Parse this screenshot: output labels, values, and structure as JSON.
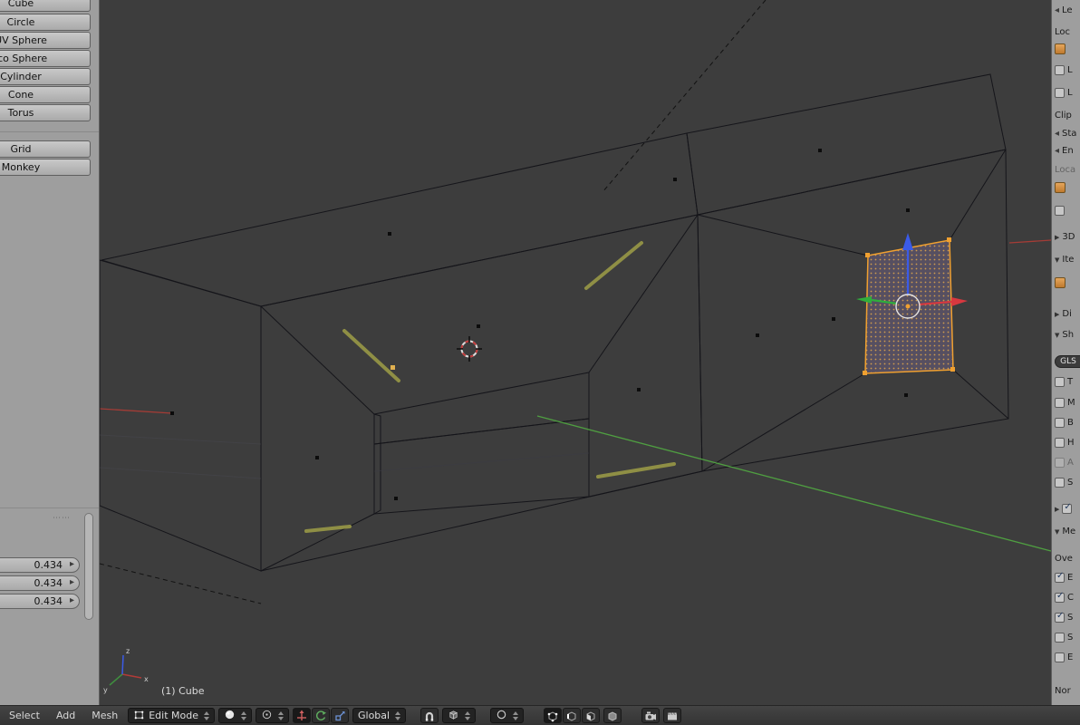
{
  "icons": {
    "dropdown_updown": "up-down arrows",
    "panel_open": "▼",
    "panel_closed": "▶",
    "slider_left": "◂",
    "slider_right": "▸",
    "checkmark": "✓"
  },
  "colors": {
    "selection_accent": "#f0a030",
    "axis_x": "#b23b38",
    "axis_y": "#4f9e41",
    "axis_z": "#3b5be8",
    "viewport_bg": "#3d3d3d",
    "face_front": "#51515e",
    "face_top": "#70707a",
    "face_cap": "#9b9b9d"
  },
  "tool_shelf": {
    "primitive_buttons": [
      "Cube",
      "Circle",
      "UV Sphere",
      "Ico Sphere",
      "Cylinder",
      "Cone",
      "Torus"
    ],
    "extra_buttons": [
      "Grid",
      "Monkey"
    ],
    "transform_fields": [
      "0.434",
      "0.434",
      "0.434"
    ]
  },
  "viewport": {
    "object_info": "(1) Cube",
    "mini_axis": {
      "x": "x",
      "y": "y",
      "z": "z"
    }
  },
  "header": {
    "menus": [
      "Select",
      "Add",
      "Mesh"
    ],
    "mode_dropdown": "Edit Mode",
    "orientation_dropdown": "Global"
  },
  "properties_panel": {
    "rows": [
      {
        "label": "Le"
      },
      {
        "label": "Loc"
      },
      {
        "label": ""
      },
      {
        "label": "L"
      },
      {
        "label": "L"
      },
      {
        "label": "Clip"
      },
      {
        "label": "Sta"
      },
      {
        "label": "En"
      },
      {
        "label": "Loca"
      },
      {
        "label": ""
      },
      {
        "label": ""
      },
      {
        "label": "3D"
      },
      {
        "label": "Ite"
      },
      {
        "label": ""
      },
      {
        "label": "Di"
      },
      {
        "label": "Sh"
      },
      {
        "label": "GLS"
      },
      {
        "label": "T"
      },
      {
        "label": "M"
      },
      {
        "label": "B"
      },
      {
        "label": "H"
      },
      {
        "label": "A"
      },
      {
        "label": "S"
      },
      {
        "label": ""
      },
      {
        "label": "Me"
      },
      {
        "label": "Ove"
      },
      {
        "label": "E"
      },
      {
        "label": "C"
      },
      {
        "label": "S"
      },
      {
        "label": "S"
      },
      {
        "label": "E"
      },
      {
        "label": "Nor"
      }
    ]
  }
}
